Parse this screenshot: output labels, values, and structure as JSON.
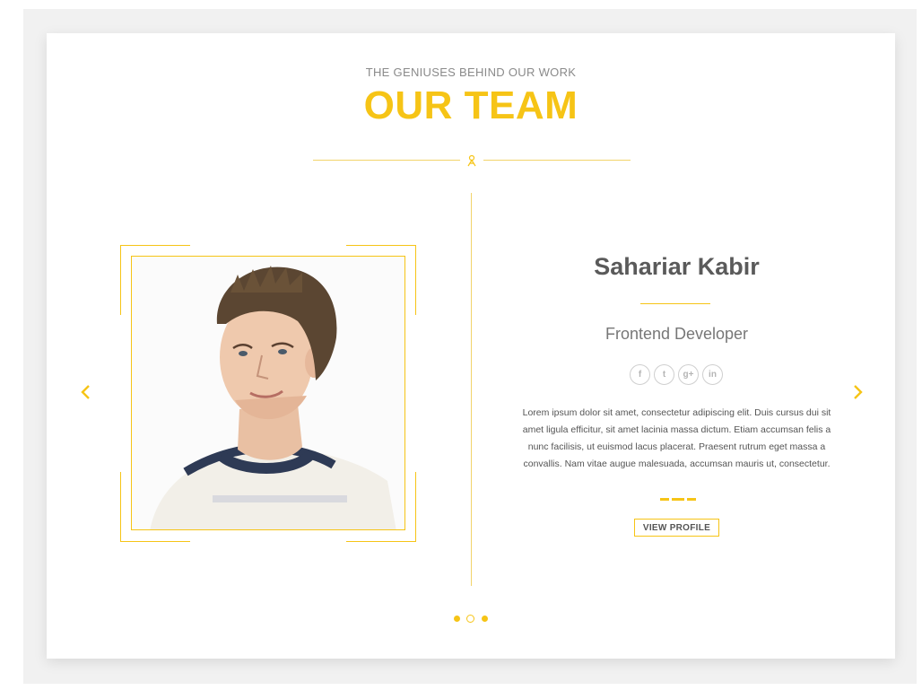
{
  "header": {
    "eyebrow": "THE GENIUSES BEHIND OUR WORK",
    "title": "OUR TEAM"
  },
  "colors": {
    "accent": "#f6c416",
    "text_dark": "#5a5a5a",
    "text_muted": "#8a8a8a"
  },
  "member": {
    "name": "Sahariar Kabir",
    "role": "Frontend Developer",
    "bio": "Lorem ipsum dolor sit amet, consectetur adipiscing elit. Duis cursus dui sit amet ligula efficitur, sit amet lacinia massa dictum. Etiam accumsan felis a nunc facilisis, ut euismod lacus placerat. Praesent rutrum eget massa a convallis. Nam vitae augue malesuada, accumsan mauris ut, consectetur.",
    "button_label": "VIEW PROFILE",
    "socials": [
      {
        "icon": "facebook-icon",
        "glyph": "f"
      },
      {
        "icon": "twitter-icon",
        "glyph": "t"
      },
      {
        "icon": "google-plus-icon",
        "glyph": "g+"
      },
      {
        "icon": "linkedin-icon",
        "glyph": "in"
      }
    ]
  },
  "carousel": {
    "slide_count": 3,
    "active_slide": 2,
    "prev_icon": "chevron-left-icon",
    "next_icon": "chevron-right-icon"
  }
}
